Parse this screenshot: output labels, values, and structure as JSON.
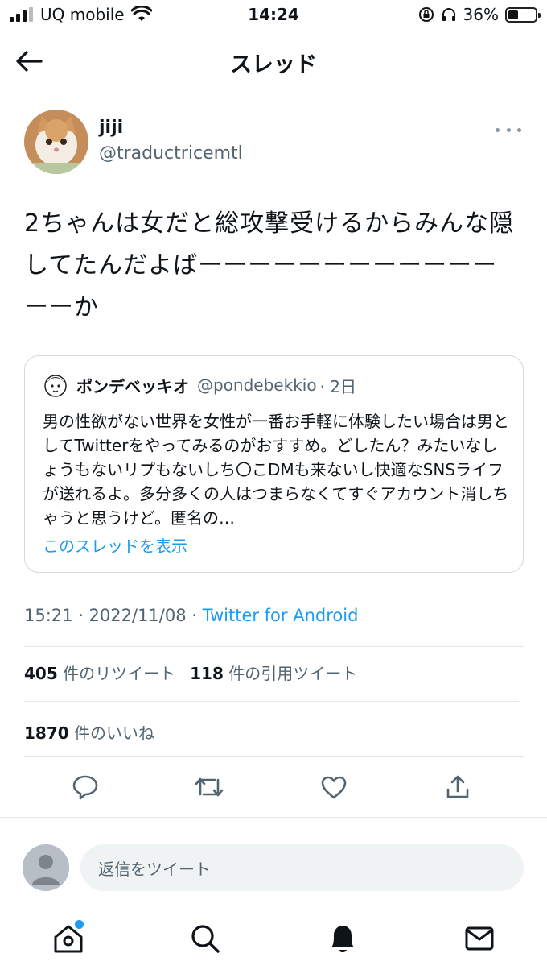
{
  "status_bar": {
    "carrier": "UQ mobile",
    "time": "14:24",
    "battery": "36%",
    "battery_level": 0.36
  },
  "header": {
    "title": "スレッド"
  },
  "tweet": {
    "author_name": "jiji",
    "author_handle": "@traductricemtl",
    "text": "2ちゃんは女だと総攻撃受けるからみんな隠してたんだよばーーーーーーーーーーーーーーか",
    "timestamp": "15:21 · 2022/11/08 · ",
    "source": "Twitter for Android"
  },
  "quoted_tweet": {
    "author_name": "ポンデベッキオ",
    "author_handle": "@pondebekkio",
    "date": "· 2日",
    "text": "男の性欲がない世界を女性が一番お手軽に体験したい場合は男としてTwitterをやってみるのがおすすめ。どしたん？みたいなしょうもないリプもないしち〇こDMも来ないし快適なSNSライフが送れるよ。多分多くの人はつまらなくてすぐアカウント消しちゃうと思うけど。匿名の…",
    "show_thread": "このスレッドを表示"
  },
  "stats": {
    "retweets_count": "405",
    "retweets_label": "件のリツイート",
    "quotes_count": "118",
    "quotes_label": "件の引用ツイート",
    "likes_count": "1870",
    "likes_label": "件のいいね"
  },
  "reply": {
    "placeholder": "返信をツイート"
  },
  "icons": {
    "back": "arrow-left-icon",
    "more": "more-horizontal-icon",
    "reply": "comment-icon",
    "retweet": "retweet-icon",
    "like": "heart-icon",
    "share": "share-icon",
    "home": "home-icon",
    "search": "search-icon",
    "notifications": "bell-icon",
    "messages": "mail-icon"
  },
  "colors": {
    "accent": "#1d9bf0",
    "secondary_text": "#536471",
    "divider": "#e4e8eb"
  }
}
